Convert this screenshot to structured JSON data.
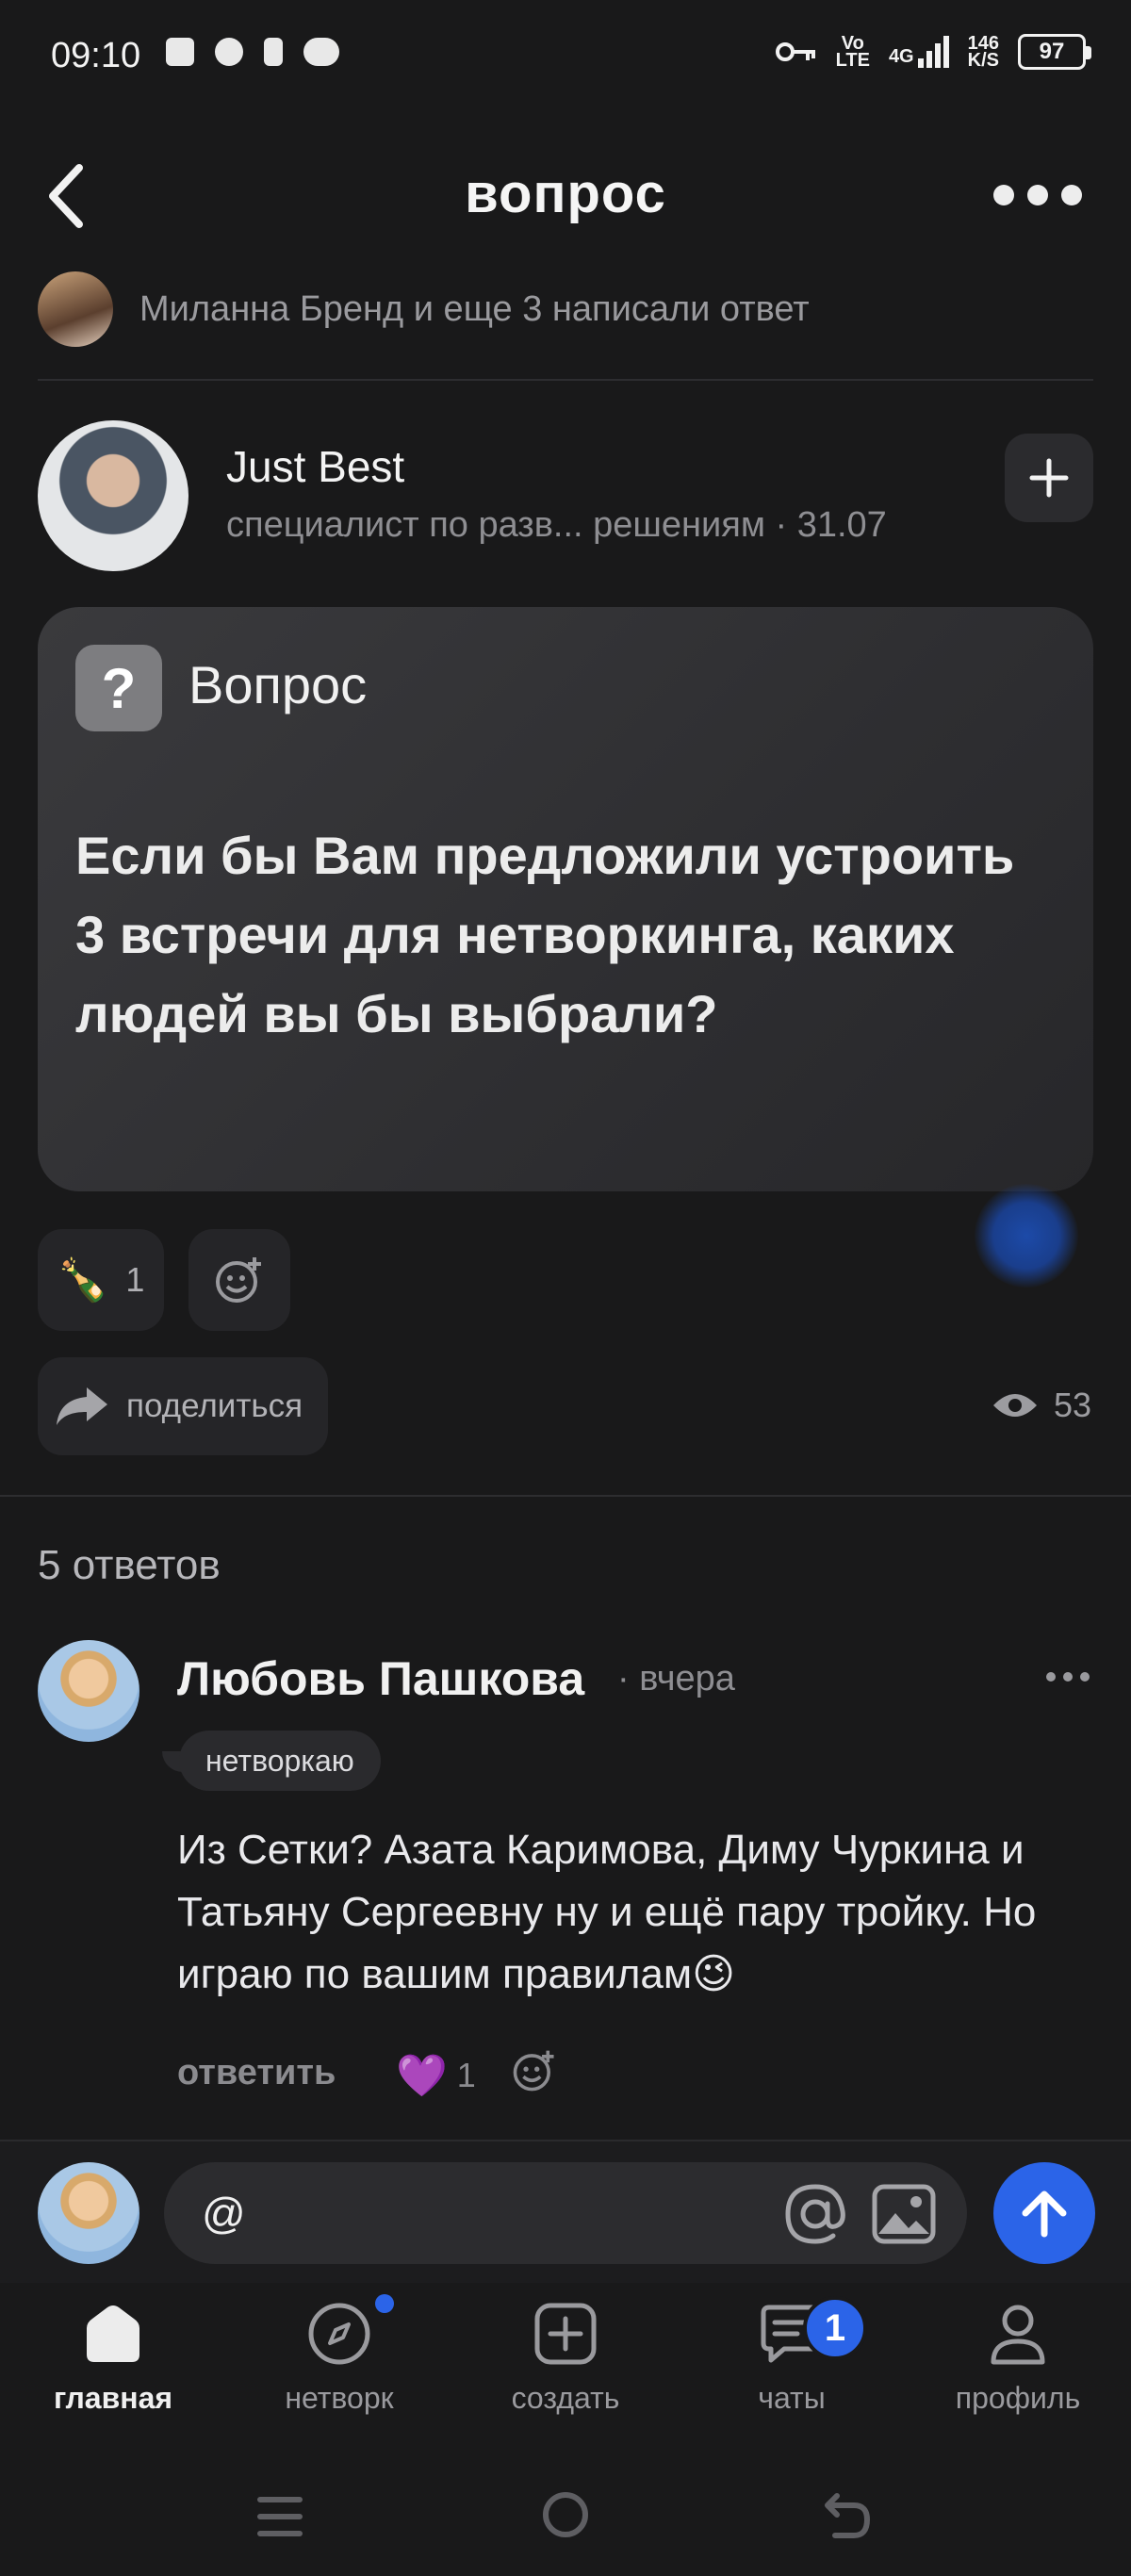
{
  "status_bar": {
    "time": "09:10",
    "network_top": "Vo",
    "network_bottom": "LTE",
    "net_type": "4G",
    "speed_top": "146",
    "speed_bottom": "K/S",
    "battery": "97"
  },
  "header": {
    "title": "вопрос"
  },
  "answer_hint": {
    "text": "Миланна Бренд и еще 3 написали ответ"
  },
  "author": {
    "name": "Just Best",
    "meta": "специалист по разв... решениям · 31.07"
  },
  "question": {
    "icon_glyph": "?",
    "label": "Вопрос",
    "text": "Если бы Вам предложили устроить 3 встречи для нетворкинга, каких людей вы бы выбрали?"
  },
  "reactions": {
    "emoji": "🍾",
    "count": "1"
  },
  "share": {
    "label": "поделиться"
  },
  "views": {
    "count": "53"
  },
  "answers": {
    "count_label": "5 ответов"
  },
  "comment": {
    "author": "Любовь Пашкова",
    "time": "· вчера",
    "tag": "нетворкаю",
    "text": "Из Сетки? Азата Каримова, Диму Чуркина и Татьяну Сергеевну ну и ещё пару тройку. Но играю по вашим правилам😉",
    "reply_label": "ответить",
    "like_emoji": "💜",
    "like_count": "1"
  },
  "composer": {
    "value": "@"
  },
  "bottom_nav": {
    "items": [
      {
        "label": "главная",
        "icon": "home-icon"
      },
      {
        "label": "нетворк",
        "icon": "compass-icon"
      },
      {
        "label": "создать",
        "icon": "plus-square-icon"
      },
      {
        "label": "чаты",
        "icon": "chat-icon"
      },
      {
        "label": "профиль",
        "icon": "profile-icon"
      }
    ],
    "chats_badge": "1"
  },
  "colors": {
    "background": "#19191a",
    "accent": "#2b64e8",
    "card": "#2e2e31"
  }
}
